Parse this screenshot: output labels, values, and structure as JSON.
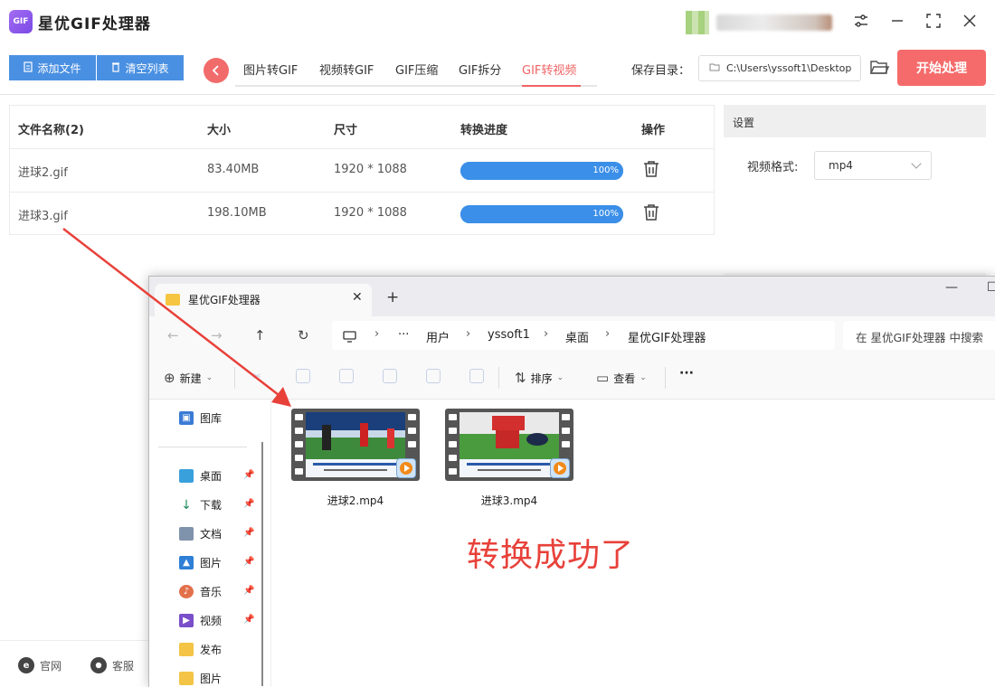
{
  "app": {
    "logo_text": "GIF",
    "title": "星优GIF处理器"
  },
  "toolbar": {
    "add_files": "添加文件",
    "clear_list": "清空列表",
    "tabs": [
      "图片转GIF",
      "视频转GIF",
      "GIF压缩",
      "GIF拆分",
      "GIF转视频"
    ],
    "active_tab": "GIF转视频",
    "save_dir_label": "保存目录：",
    "save_dir_value": "C:\\Users\\yssoft1\\Desktop",
    "start_button": "开始处理"
  },
  "table": {
    "headers": [
      "文件名称(2)",
      "大小",
      "尺寸",
      "转换进度",
      "操作"
    ],
    "rows": [
      {
        "name": "进球2.gif",
        "size": "83.40MB",
        "dimensions": "1920 * 1088",
        "progress_text": "100%",
        "progress": 1.0
      },
      {
        "name": "进球3.gif",
        "size": "198.10MB",
        "dimensions": "1920 * 1088",
        "progress_text": "100%",
        "progress": 1.0
      }
    ]
  },
  "settings": {
    "title": "设置",
    "format_label": "视频格式:",
    "format_value": "mp4"
  },
  "footer": {
    "website": "官网",
    "support": "客服"
  },
  "explorer": {
    "tab_title": "星优GIF处理器",
    "breadcrumb": [
      "用户",
      "yssoft1",
      "桌面",
      "星优GIF处理器"
    ],
    "search_placeholder": "在 星优GIF处理器 中搜索",
    "cmd": {
      "new": "新建",
      "sort": "排序",
      "view": "查看"
    },
    "sidebar_top": "图库",
    "sidebar": [
      "桌面",
      "下载",
      "文档",
      "图片",
      "音乐",
      "视频",
      "发布",
      "图片"
    ],
    "files": [
      {
        "name": "进球2.mp4"
      },
      {
        "name": "进球3.mp4"
      }
    ]
  },
  "annotation": {
    "success_text": "转换成功了"
  },
  "colors": {
    "accent_red": "#f06464",
    "progress_blue": "#3b8fe8",
    "button_blue": "#4a90e2",
    "annotation_red": "#e8413a"
  }
}
